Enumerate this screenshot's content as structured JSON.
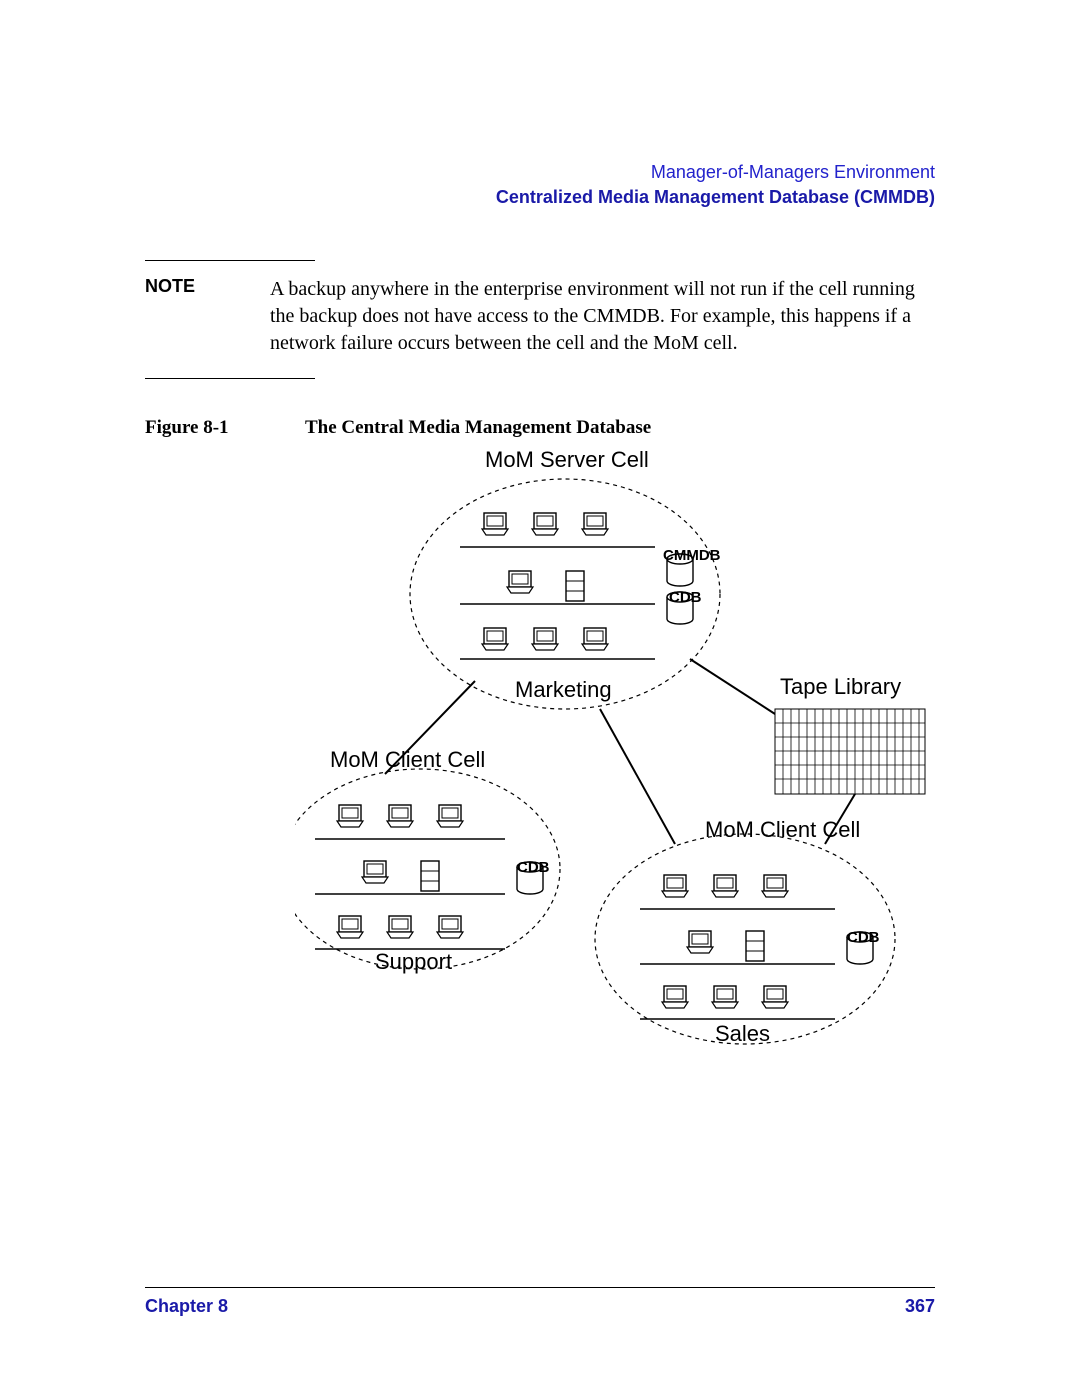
{
  "header": {
    "line1": "Manager-of-Managers Environment",
    "line2": "Centralized Media Management Database (CMMDB)"
  },
  "note": {
    "label": "NOTE",
    "body": "A backup anywhere in the enterprise environment will not run if the cell running the backup does not have access to the CMMDB. For example, this happens if a network failure occurs between the cell and the MoM cell."
  },
  "figure": {
    "label": "Figure 8-1",
    "title": "The Central Media Management Database"
  },
  "diagram": {
    "mom_server_cell": "MoM Server Cell",
    "mom_client_cell": "MoM Client Cell",
    "tape_library": "Tape Library",
    "marketing": "Marketing",
    "support": "Support",
    "sales": "Sales",
    "cmmdb": "CMMDB",
    "cdb": "CDB"
  },
  "footer": {
    "chapter": "Chapter 8",
    "page": "367"
  }
}
